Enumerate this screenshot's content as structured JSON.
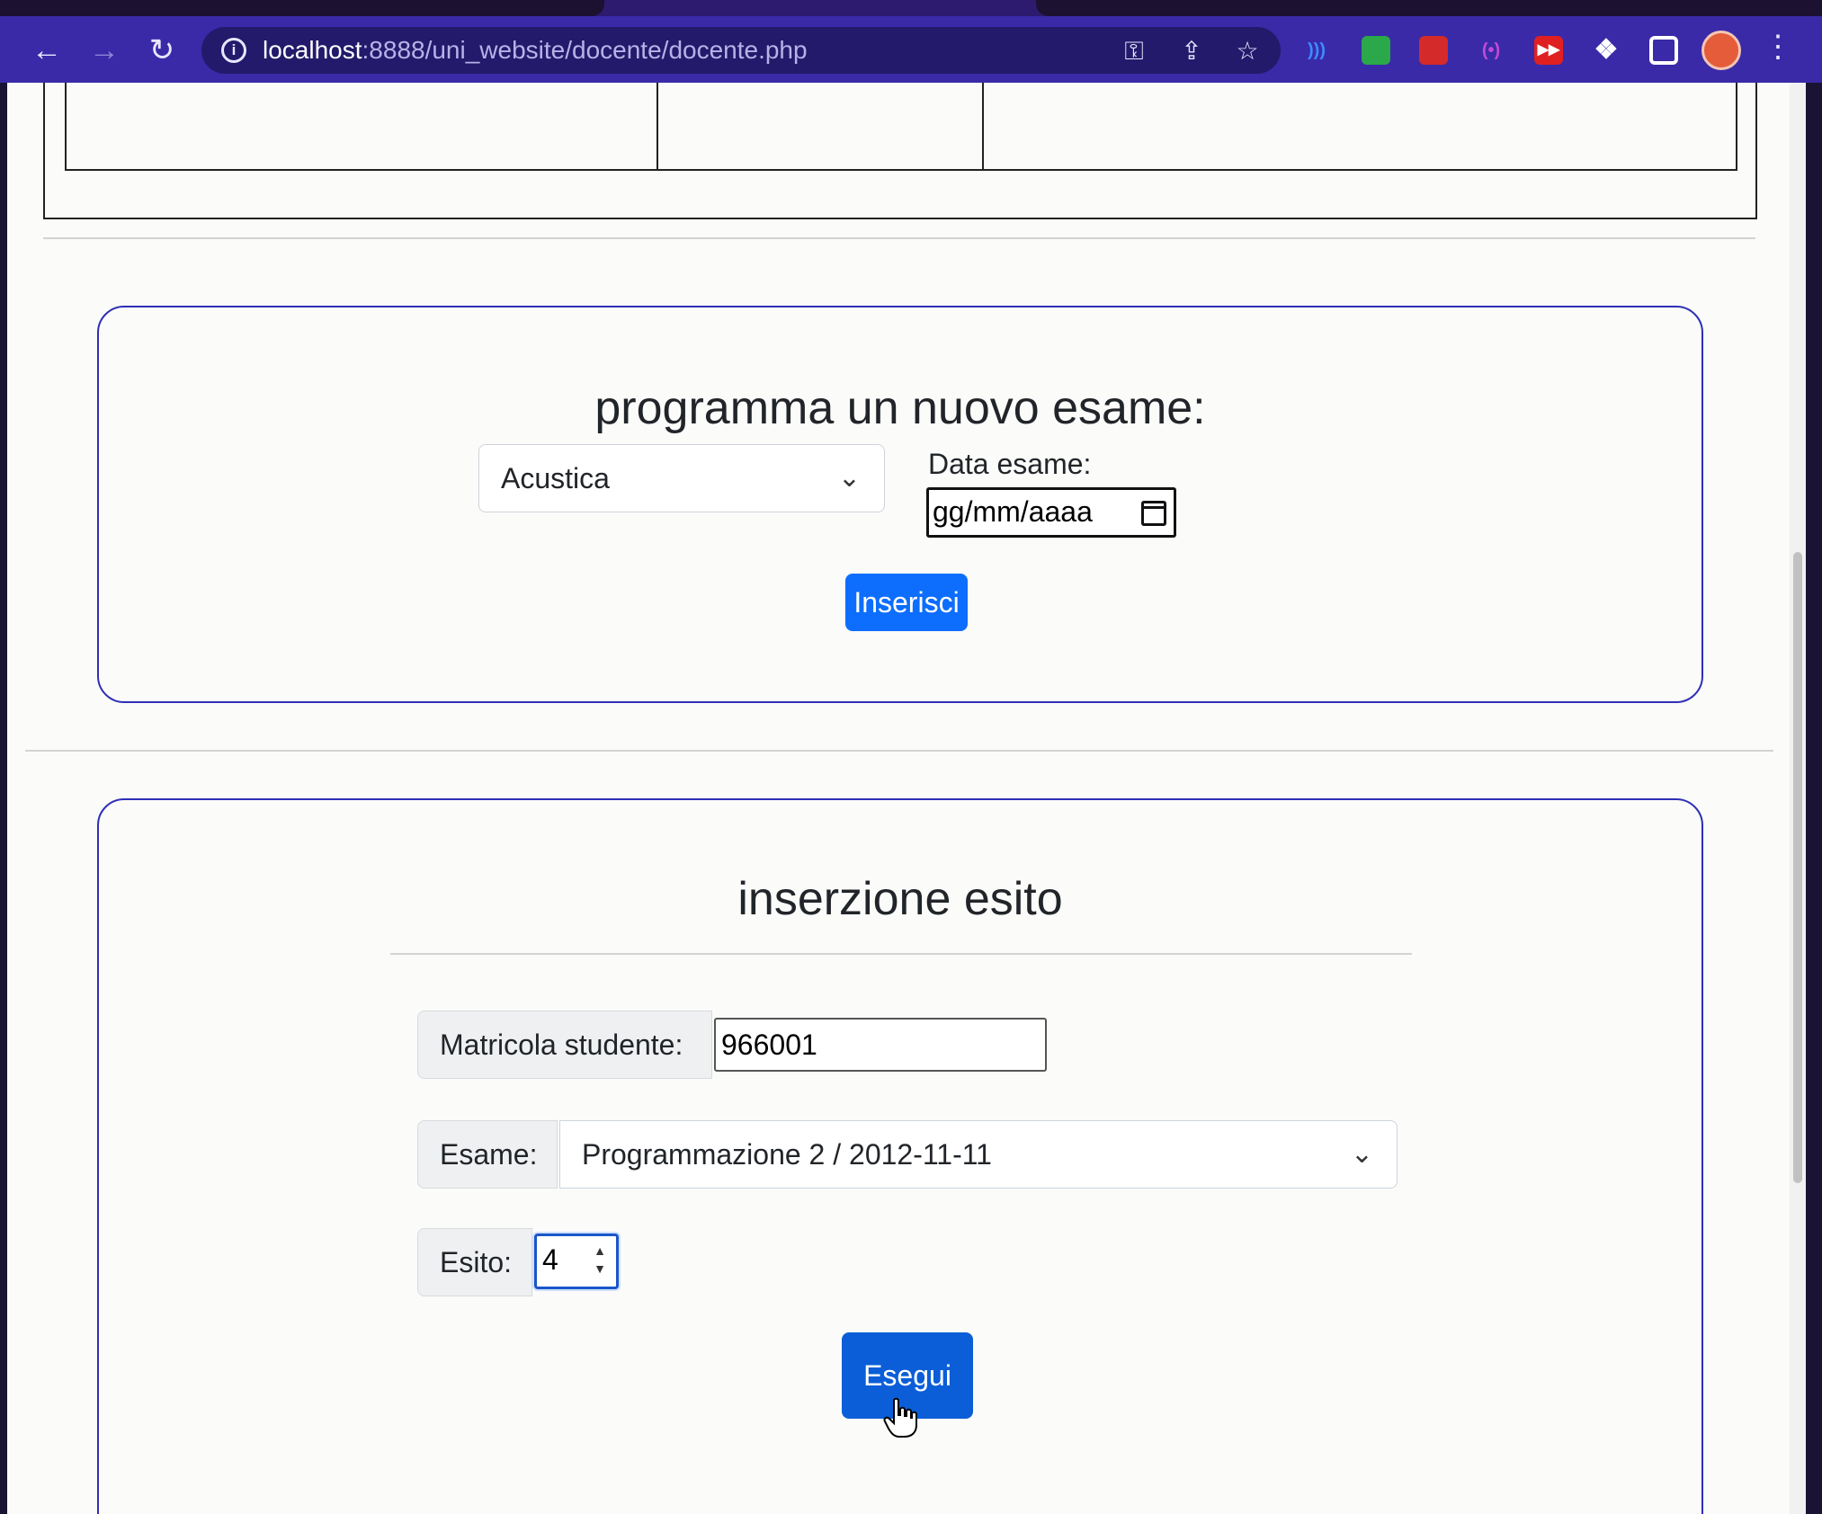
{
  "browser": {
    "url_host": "localhost",
    "url_path": ":8888/uni_website/docente/docente.php",
    "back_icon": "arrow-left-icon",
    "forward_icon": "arrow-right-icon",
    "reload_icon": "reload-icon"
  },
  "schedule_exam": {
    "title": "programma un nuovo esame:",
    "course_selected": "Acustica",
    "date_label": "Data esame:",
    "date_placeholder": "gg/mm/aaaa",
    "submit_label": "Inserisci"
  },
  "insert_result": {
    "title": "inserzione esito",
    "student_id_label": "Matricola studente:",
    "student_id_value": "966001",
    "exam_label": "Esame:",
    "exam_selected": "Programmazione 2 / 2012-11-11",
    "result_label": "Esito:",
    "result_value": "4",
    "submit_label": "Esegui"
  },
  "colors": {
    "toolbar": "#3a2aa8",
    "card_border": "#2f2fb6",
    "primary": "#0d6efd"
  }
}
